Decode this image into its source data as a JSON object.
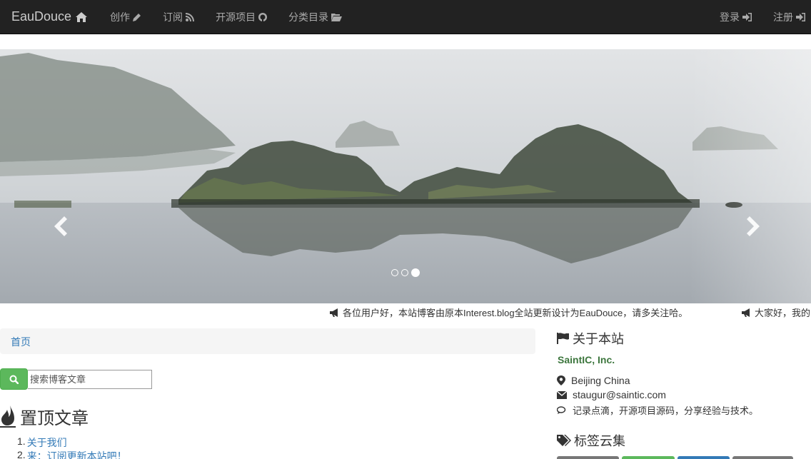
{
  "navbar": {
    "brand": "EauDouce",
    "left_items": [
      {
        "label": "创作",
        "icon": "pencil-icon"
      },
      {
        "label": "订阅",
        "icon": "rss-icon"
      },
      {
        "label": "开源项目",
        "icon": "github-icon"
      },
      {
        "label": "分类目录",
        "icon": "folder-open-icon"
      }
    ],
    "right_items": [
      {
        "label": "登录",
        "icon": "sign-in-icon"
      },
      {
        "label": "注册",
        "icon": "sign-in-icon"
      }
    ]
  },
  "carousel": {
    "indicator_count": 3,
    "active_index": 2,
    "prev_icon": "chevron-left-icon",
    "next_icon": "chevron-right-icon"
  },
  "marquee": {
    "messages": [
      "各位用户好，本站博客由原本Interest.blog全站更新设计为EauDouce，请多关注哈。",
      "大家好，我的"
    ]
  },
  "breadcrumb": {
    "home": "首页"
  },
  "search": {
    "placeholder": "搜索博客文章"
  },
  "top_articles": {
    "title": "置顶文章",
    "items": [
      {
        "num": "1.",
        "label": "关于我们"
      },
      {
        "num": "2.",
        "label": "来：订阅更新本站吧！"
      }
    ]
  },
  "sidebar": {
    "about_title": "关于本站",
    "org": "SaintIC, Inc.",
    "location": "Beijing China",
    "email": "staugur@saintic.com",
    "slogan": "记录点滴，开源项目源码，分享经验与技术。",
    "tags_title": "标签云集",
    "tag_colors": [
      "#777777",
      "#5cb85c",
      "#337ab7",
      "#777777"
    ]
  },
  "colors": {
    "navbar_bg": "#222222",
    "link": "#337ab7",
    "success": "#5cb85c",
    "org_text": "#3c763d"
  }
}
